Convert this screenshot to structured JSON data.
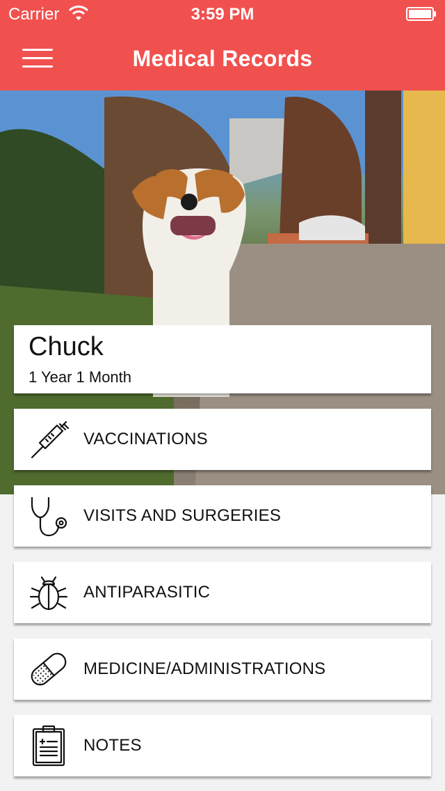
{
  "status_bar": {
    "carrier": "Carrier",
    "time": "3:59 PM"
  },
  "header": {
    "title": "Medical Records",
    "menu_icon": "hamburger-menu-icon",
    "background_color": "#f0514f"
  },
  "pet": {
    "name": "Chuck",
    "age": "1 Year 1 Month",
    "photo": "dog-photo"
  },
  "menu": {
    "items": [
      {
        "label": "VACCINATIONS",
        "icon": "syringe-icon"
      },
      {
        "label": "VISITS AND SURGERIES",
        "icon": "stethoscope-icon"
      },
      {
        "label": "ANTIPARASITIC",
        "icon": "bug-icon"
      },
      {
        "label": "MEDICINE/ADMINISTRATIONS",
        "icon": "pill-icon"
      },
      {
        "label": "NOTES",
        "icon": "clipboard-icon"
      }
    ]
  }
}
